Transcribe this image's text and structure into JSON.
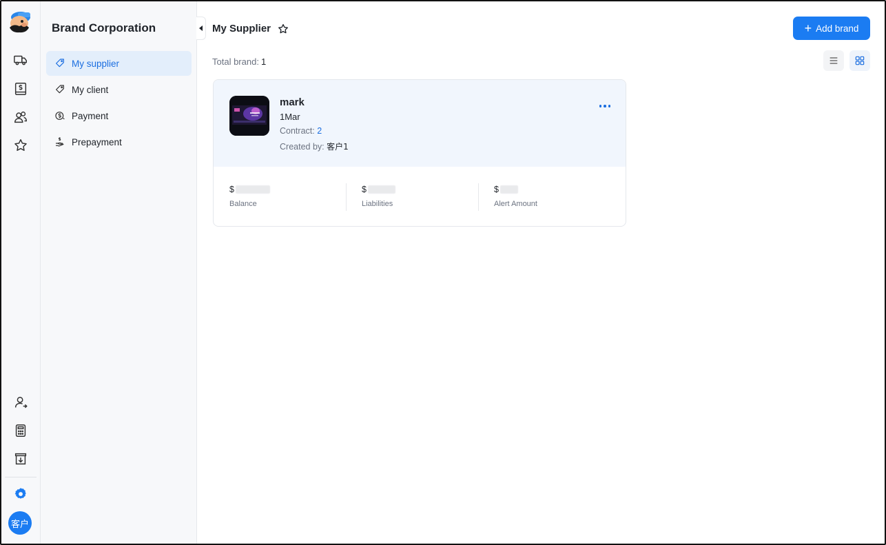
{
  "app": {
    "title": "Brand Corporation"
  },
  "rail": {
    "avatar_text": "客户",
    "icons": [
      "truck-icon",
      "dollar-document-icon",
      "users-icon",
      "star-icon",
      "user-add-icon",
      "calculator-icon",
      "download-box-icon",
      "settings-icon"
    ]
  },
  "sidebar": {
    "items": [
      {
        "label": "My supplier",
        "icon": "tag-icon",
        "active": true
      },
      {
        "label": "My client",
        "icon": "tag-icon",
        "active": false
      },
      {
        "label": "Payment",
        "icon": "dollar-circle-icon",
        "active": false
      },
      {
        "label": "Prepayment",
        "icon": "hand-dollar-icon",
        "active": false
      }
    ]
  },
  "main": {
    "page_title": "My Supplier",
    "add_button": "Add brand",
    "total_label": "Total brand:",
    "total_value": "1"
  },
  "card": {
    "name": "mark",
    "subtitle": "1Mar",
    "contract_label": "Contract:",
    "contract_value": "2",
    "created_label": "Created by:",
    "created_value": "客户1",
    "stats": [
      {
        "currency": "$",
        "label": "Balance"
      },
      {
        "currency": "$",
        "label": "Liabilities"
      },
      {
        "currency": "$",
        "label": "Alert Amount"
      }
    ]
  },
  "colors": {
    "accent": "#1b7cf2",
    "active_bg": "#e3eefb",
    "card_header_bg": "#f1f6fd"
  }
}
